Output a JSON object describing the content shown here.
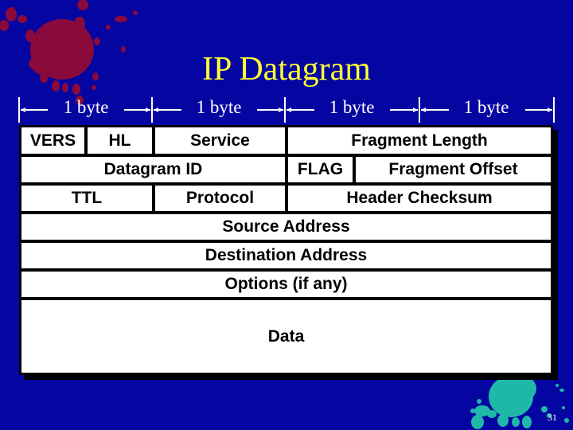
{
  "slide": {
    "title": "IP Datagram",
    "page_number": "31",
    "colors": {
      "background": "#0505a2",
      "title": "#ffff33",
      "splat_top_left": "#8b0a3c",
      "splat_bottom_right": "#1fb8a8",
      "table_fill": "#ffffff",
      "table_border": "#000000"
    }
  },
  "ruler": {
    "labels": [
      "1 byte",
      "1 byte",
      "1 byte",
      "1 byte"
    ]
  },
  "header_fields": {
    "row1": {
      "vers": "VERS",
      "hl": "HL",
      "service": "Service",
      "fragment_length": "Fragment Length"
    },
    "row2": {
      "datagram_id": "Datagram ID",
      "flag": "FLAG",
      "fragment_offset": "Fragment Offset"
    },
    "row3": {
      "ttl": "TTL",
      "protocol": "Protocol",
      "header_checksum": "Header Checksum"
    },
    "row4": {
      "source_address": "Source Address"
    },
    "row5": {
      "destination_address": "Destination Address"
    },
    "row6": {
      "options": "Options (if any)"
    },
    "row7": {
      "data": "Data"
    }
  }
}
